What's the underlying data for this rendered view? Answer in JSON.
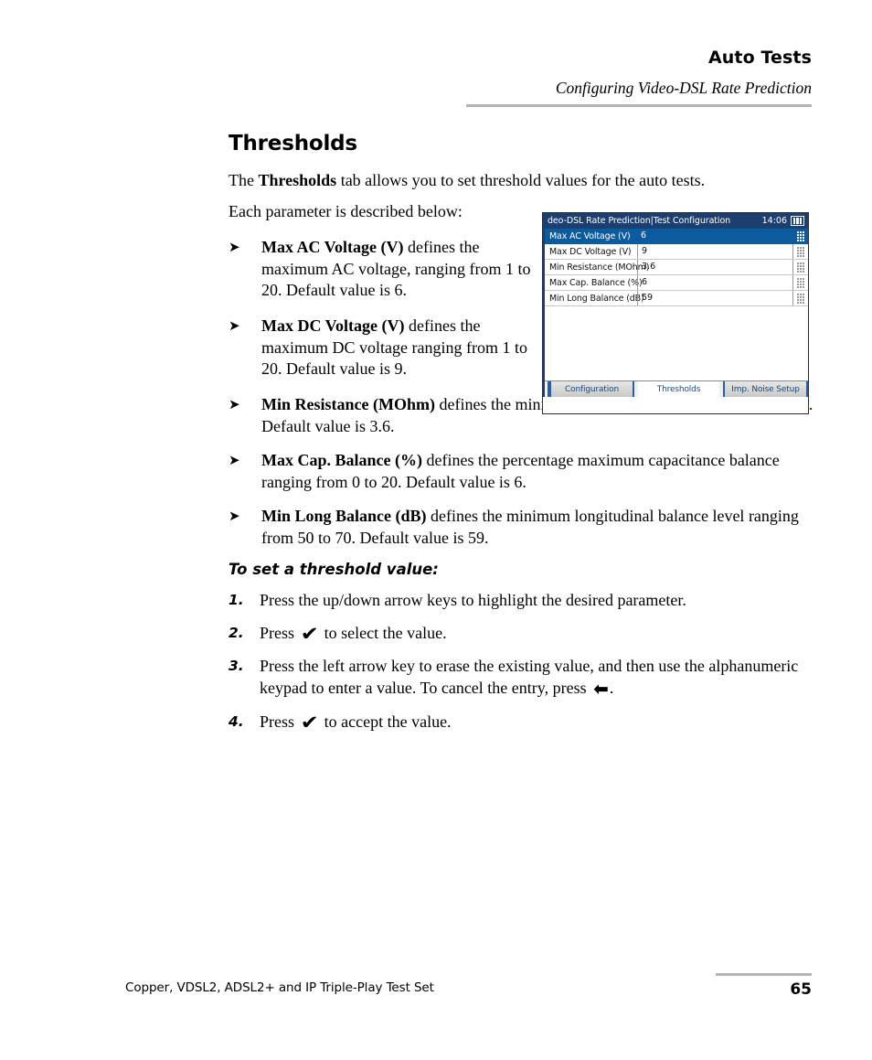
{
  "header": {
    "title": "Auto Tests",
    "subtitle": "Configuring Video-DSL Rate Prediction"
  },
  "section": {
    "heading": "Thresholds",
    "intro_prefix": "The ",
    "intro_bold": "Thresholds",
    "intro_suffix": " tab allows you to set threshold values for the auto tests.",
    "each_param": "Each parameter is described below:"
  },
  "bullets": [
    {
      "marker": "➤",
      "term": "Max AC Voltage (V)",
      "text": " defines the maximum AC voltage, ranging from 1 to 20. Default value is 6."
    },
    {
      "marker": "➤",
      "term": "Max DC Voltage (V)",
      "text": " defines the maximum DC voltage ranging from 1 to 20. Default value is 9."
    },
    {
      "marker": "➤",
      "term": "Min Resistance (MOhm)",
      "text": " defines the minimum resistance ranging from 0.5 to 100. Default value is 3.6."
    },
    {
      "marker": "➤",
      "term": "Max Cap. Balance (%)",
      "text": " defines the percentage maximum capacitance balance ranging from 0 to 20. Default value is 6."
    },
    {
      "marker": "➤",
      "term": "Min Long Balance (dB)",
      "text": " defines the minimum longitudinal balance level ranging from 50 to 70. Default value is 59."
    }
  ],
  "procedure": {
    "heading": "To set a threshold value:",
    "steps": [
      {
        "number": "1.",
        "pre": "Press the up/down arrow keys to highlight the desired parameter.",
        "glyph": "",
        "post": ""
      },
      {
        "number": "2.",
        "pre": "Press ",
        "glyph": "✔",
        "post": " to select the value."
      },
      {
        "number": "3.",
        "pre": "Press the left arrow key to erase the existing value, and then use the alphanumeric keypad to enter a value. To cancel the entry, press ",
        "glyph": "⬅",
        "post": "."
      },
      {
        "number": "4.",
        "pre": "Press ",
        "glyph": "✔",
        "post": " to accept the value."
      }
    ]
  },
  "device": {
    "title": "deo-DSL Rate Prediction|Test Configuration",
    "time": "14:06",
    "battery_icon": "battery-icon",
    "rows": [
      {
        "label": "Max AC Voltage (V)",
        "value": "6",
        "selected": true
      },
      {
        "label": "Max DC Voltage (V)",
        "value": "9",
        "selected": false
      },
      {
        "label": "Min Resistance (MOhm)",
        "value": "3.6",
        "selected": false
      },
      {
        "label": "Max Cap. Balance (%)",
        "value": "6",
        "selected": false
      },
      {
        "label": "Min Long Balance (dB)",
        "value": "59",
        "selected": false
      }
    ],
    "tabs": [
      {
        "label": "Configuration",
        "active": false
      },
      {
        "label": "Thresholds",
        "active": true
      },
      {
        "label": "Imp. Noise Setup",
        "active": false
      }
    ],
    "colors": {
      "titlebar": "#1c3f70",
      "selected_row": "#0b5c9e",
      "tab_text": "#174a86",
      "tab_border": "#2a5ea8"
    }
  },
  "footer": {
    "product": "Copper, VDSL2, ADSL2+ and IP Triple-Play Test Set",
    "page_number": "65"
  }
}
